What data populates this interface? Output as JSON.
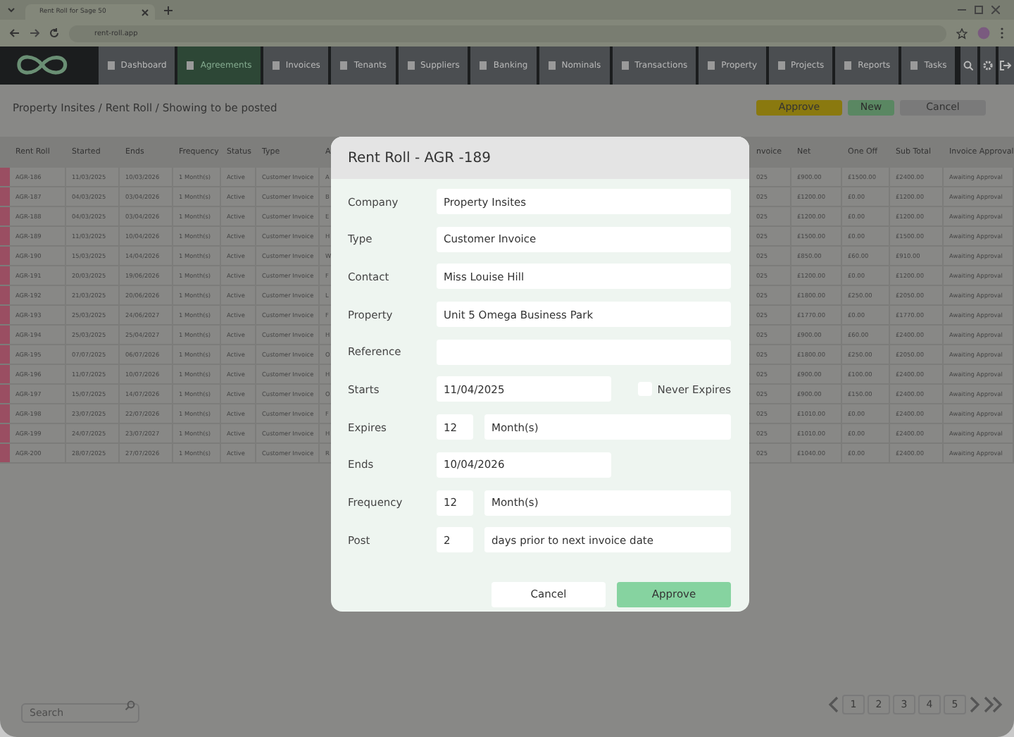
{
  "browser": {
    "tab_title": "Rent Roll for Sage 50",
    "url": "rent-roll.app"
  },
  "nav": {
    "items": [
      {
        "label": "Dashboard",
        "selected": false
      },
      {
        "label": "Agreements",
        "selected": true
      },
      {
        "label": "Invoices",
        "selected": false
      },
      {
        "label": "Tenants",
        "selected": false
      },
      {
        "label": "Suppliers",
        "selected": false
      },
      {
        "label": "Banking",
        "selected": false
      },
      {
        "label": "Nominals",
        "selected": false
      },
      {
        "label": "Transactions",
        "selected": false
      },
      {
        "label": "Property",
        "selected": false
      },
      {
        "label": "Projects",
        "selected": false
      },
      {
        "label": "Reports",
        "selected": false
      },
      {
        "label": "Tasks",
        "selected": false
      }
    ]
  },
  "breadcrumb": "Property Insites / Rent Roll / Showing to be posted",
  "actions": [
    {
      "label": "Approve",
      "kind": "approve"
    },
    {
      "label": "New",
      "kind": "new"
    },
    {
      "label": "Cancel",
      "kind": "cancel"
    }
  ],
  "table": {
    "columns": [
      "Rent Roll",
      "Started",
      "Ends",
      "Frequency",
      "Status",
      "Type",
      "A",
      "nvoice",
      "Net",
      "One Off",
      "Sub Total",
      "Invoice Approval"
    ],
    "rows": [
      [
        "AGR-186",
        "11/03/2025",
        "10/03/2026",
        "1 Month(s)",
        "Active",
        "Customer Invoice",
        "A",
        "025",
        "£900.00",
        "£1500.00",
        "£2400.00",
        "Awaiting Approval"
      ],
      [
        "AGR-187",
        "04/03/2025",
        "03/04/2026",
        "1 Month(s)",
        "Active",
        "Customer Invoice",
        "B",
        "025",
        "£1200.00",
        "£0.00",
        "£1200.00",
        "Awaiting Approval"
      ],
      [
        "AGR-188",
        "04/03/2025",
        "03/04/2026",
        "1 Month(s)",
        "Active",
        "Customer Invoice",
        "E",
        "025",
        "£1200.00",
        "£0.00",
        "£1200.00",
        "Awaiting Approval"
      ],
      [
        "AGR-189",
        "11/03/2025",
        "10/04/2026",
        "1 Month(s)",
        "Active",
        "Customer Invoice",
        "H",
        "025",
        "£1500.00",
        "£0.00",
        "£1500.00",
        "Awaiting Approval"
      ],
      [
        "AGR-190",
        "15/03/2025",
        "14/04/2026",
        "1 Month(s)",
        "Active",
        "Customer Invoice",
        "W",
        "025",
        "£850.00",
        "£60.00",
        "£910.00",
        "Awaiting Approval"
      ],
      [
        "AGR-191",
        "20/03/2025",
        "19/06/2026",
        "1 Month(s)",
        "Active",
        "Customer Invoice",
        "F",
        "025",
        "£1200.00",
        "£0.00",
        "£1200.00",
        "Awaiting Approval"
      ],
      [
        "AGR-192",
        "21/03/2025",
        "20/06/2026",
        "1 Month(s)",
        "Active",
        "Customer Invoice",
        "L",
        "025",
        "£1800.00",
        "£250.00",
        "£2050.00",
        "Awaiting Approval"
      ],
      [
        "AGR-193",
        "25/03/2025",
        "24/06/2027",
        "1 Month(s)",
        "Active",
        "Customer Invoice",
        "F",
        "025",
        "£1770.00",
        "£0.00",
        "£1770.00",
        "Awaiting Approval"
      ],
      [
        "AGR-194",
        "25/03/2025",
        "25/04/2027",
        "1 Month(s)",
        "Active",
        "Customer Invoice",
        "H",
        "025",
        "£900.00",
        "£60.00",
        "£2400.00",
        "Awaiting Approval"
      ],
      [
        "AGR-195",
        "07/07/2025",
        "06/07/2026",
        "1 Month(s)",
        "Active",
        "Customer Invoice",
        "O",
        "025",
        "£1800.00",
        "£250.00",
        "£2050.00",
        "Awaiting Approval"
      ],
      [
        "AGR-196",
        "11/07/2025",
        "10/07/2026",
        "1 Month(s)",
        "Active",
        "Customer Invoice",
        "H",
        "025",
        "£900.00",
        "£100.00",
        "£2400.00",
        "Awaiting Approval"
      ],
      [
        "AGR-197",
        "15/07/2025",
        "14/07/2026",
        "1 Month(s)",
        "Active",
        "Customer Invoice",
        "O",
        "025",
        "£900.00",
        "£150.00",
        "£2400.00",
        "Awaiting Approval"
      ],
      [
        "AGR-198",
        "23/07/2025",
        "22/07/2026",
        "1 Month(s)",
        "Active",
        "Customer Invoice",
        "F",
        "025",
        "£1010.00",
        "£0.00",
        "£2400.00",
        "Awaiting Approval"
      ],
      [
        "AGR-199",
        "24/07/2025",
        "23/07/2027",
        "1 Month(s)",
        "Active",
        "Customer Invoice",
        "H",
        "025",
        "£1010.00",
        "£0.00",
        "£2400.00",
        "Awaiting Approval"
      ],
      [
        "AGR-200",
        "28/07/2025",
        "27/07/2026",
        "1 Month(s)",
        "Active",
        "Customer Invoice",
        "R",
        "025",
        "£1040.00",
        "£0.00",
        "£2400.00",
        "Awaiting Approval"
      ]
    ]
  },
  "search": {
    "placeholder": "Search"
  },
  "pagination": {
    "pages": [
      {
        "label": "1",
        "selected": false
      },
      {
        "label": "2",
        "selected": false
      },
      {
        "label": "3",
        "selected": false
      },
      {
        "label": "4",
        "selected": false
      },
      {
        "label": "5",
        "selected": false
      }
    ]
  },
  "dialog": {
    "title": "Rent Roll - AGR -189",
    "rows": [
      {
        "label": "Company",
        "fields": [
          {
            "kind": "text",
            "value": "Property Insites"
          }
        ]
      },
      {
        "label": "Type",
        "fields": [
          {
            "kind": "text",
            "value": "Customer Invoice"
          }
        ]
      },
      {
        "label": "Contact",
        "fields": [
          {
            "kind": "text",
            "value": "Miss Louise Hill"
          }
        ]
      },
      {
        "label": "Property",
        "fields": [
          {
            "kind": "text",
            "value": "Unit 5 Omega Business Park"
          }
        ]
      },
      {
        "label": "Reference",
        "fields": [
          {
            "kind": "text"
          }
        ]
      },
      {
        "label": "Starts",
        "fields": [
          {
            "kind": "date",
            "value": "11/04/2025"
          }
        ],
        "option": {
          "label": "Never Expires",
          "checked": false
        }
      },
      {
        "label": "Expires",
        "fields": [
          {
            "kind": "number",
            "value": "12"
          },
          {
            "kind": "text",
            "value": "Month(s)"
          }
        ]
      },
      {
        "label": "Ends",
        "fields": [
          {
            "kind": "date",
            "value": "10/04/2026"
          }
        ]
      },
      {
        "label": "Frequency",
        "fields": [
          {
            "kind": "number",
            "value": "12"
          },
          {
            "kind": "text",
            "value": "Month(s)"
          }
        ]
      },
      {
        "label": "Post",
        "fields": [
          {
            "kind": "number",
            "value": "2"
          },
          {
            "kind": "text",
            "value": "days prior to next invoice date"
          }
        ]
      }
    ],
    "buttons": [
      {
        "label": "Cancel",
        "kind": "cancel"
      },
      {
        "label": "Approve",
        "kind": "approve"
      }
    ]
  }
}
